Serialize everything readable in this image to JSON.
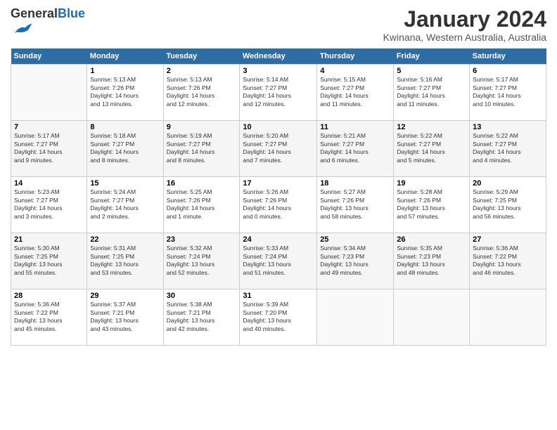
{
  "header": {
    "logo_general": "General",
    "logo_blue": "Blue",
    "title": "January 2024",
    "location": "Kwinana, Western Australia, Australia"
  },
  "columns": [
    "Sunday",
    "Monday",
    "Tuesday",
    "Wednesday",
    "Thursday",
    "Friday",
    "Saturday"
  ],
  "weeks": [
    [
      {
        "num": "",
        "info": ""
      },
      {
        "num": "1",
        "info": "Sunrise: 5:13 AM\nSunset: 7:26 PM\nDaylight: 14 hours\nand 13 minutes."
      },
      {
        "num": "2",
        "info": "Sunrise: 5:13 AM\nSunset: 7:26 PM\nDaylight: 14 hours\nand 12 minutes."
      },
      {
        "num": "3",
        "info": "Sunrise: 5:14 AM\nSunset: 7:27 PM\nDaylight: 14 hours\nand 12 minutes."
      },
      {
        "num": "4",
        "info": "Sunrise: 5:15 AM\nSunset: 7:27 PM\nDaylight: 14 hours\nand 11 minutes."
      },
      {
        "num": "5",
        "info": "Sunrise: 5:16 AM\nSunset: 7:27 PM\nDaylight: 14 hours\nand 11 minutes."
      },
      {
        "num": "6",
        "info": "Sunrise: 5:17 AM\nSunset: 7:27 PM\nDaylight: 14 hours\nand 10 minutes."
      }
    ],
    [
      {
        "num": "7",
        "info": "Sunrise: 5:17 AM\nSunset: 7:27 PM\nDaylight: 14 hours\nand 9 minutes."
      },
      {
        "num": "8",
        "info": "Sunrise: 5:18 AM\nSunset: 7:27 PM\nDaylight: 14 hours\nand 8 minutes."
      },
      {
        "num": "9",
        "info": "Sunrise: 5:19 AM\nSunset: 7:27 PM\nDaylight: 14 hours\nand 8 minutes."
      },
      {
        "num": "10",
        "info": "Sunrise: 5:20 AM\nSunset: 7:27 PM\nDaylight: 14 hours\nand 7 minutes."
      },
      {
        "num": "11",
        "info": "Sunrise: 5:21 AM\nSunset: 7:27 PM\nDaylight: 14 hours\nand 6 minutes."
      },
      {
        "num": "12",
        "info": "Sunrise: 5:22 AM\nSunset: 7:27 PM\nDaylight: 14 hours\nand 5 minutes."
      },
      {
        "num": "13",
        "info": "Sunrise: 5:22 AM\nSunset: 7:27 PM\nDaylight: 14 hours\nand 4 minutes."
      }
    ],
    [
      {
        "num": "14",
        "info": "Sunrise: 5:23 AM\nSunset: 7:27 PM\nDaylight: 14 hours\nand 3 minutes."
      },
      {
        "num": "15",
        "info": "Sunrise: 5:24 AM\nSunset: 7:27 PM\nDaylight: 14 hours\nand 2 minutes."
      },
      {
        "num": "16",
        "info": "Sunrise: 5:25 AM\nSunset: 7:26 PM\nDaylight: 14 hours\nand 1 minute."
      },
      {
        "num": "17",
        "info": "Sunrise: 5:26 AM\nSunset: 7:26 PM\nDaylight: 14 hours\nand 0 minutes."
      },
      {
        "num": "18",
        "info": "Sunrise: 5:27 AM\nSunset: 7:26 PM\nDaylight: 13 hours\nand 58 minutes."
      },
      {
        "num": "19",
        "info": "Sunrise: 5:28 AM\nSunset: 7:26 PM\nDaylight: 13 hours\nand 57 minutes."
      },
      {
        "num": "20",
        "info": "Sunrise: 5:29 AM\nSunset: 7:25 PM\nDaylight: 13 hours\nand 56 minutes."
      }
    ],
    [
      {
        "num": "21",
        "info": "Sunrise: 5:30 AM\nSunset: 7:25 PM\nDaylight: 13 hours\nand 55 minutes."
      },
      {
        "num": "22",
        "info": "Sunrise: 5:31 AM\nSunset: 7:25 PM\nDaylight: 13 hours\nand 53 minutes."
      },
      {
        "num": "23",
        "info": "Sunrise: 5:32 AM\nSunset: 7:24 PM\nDaylight: 13 hours\nand 52 minutes."
      },
      {
        "num": "24",
        "info": "Sunrise: 5:33 AM\nSunset: 7:24 PM\nDaylight: 13 hours\nand 51 minutes."
      },
      {
        "num": "25",
        "info": "Sunrise: 5:34 AM\nSunset: 7:23 PM\nDaylight: 13 hours\nand 49 minutes."
      },
      {
        "num": "26",
        "info": "Sunrise: 5:35 AM\nSunset: 7:23 PM\nDaylight: 13 hours\nand 48 minutes."
      },
      {
        "num": "27",
        "info": "Sunrise: 5:36 AM\nSunset: 7:22 PM\nDaylight: 13 hours\nand 46 minutes."
      }
    ],
    [
      {
        "num": "28",
        "info": "Sunrise: 5:36 AM\nSunset: 7:22 PM\nDaylight: 13 hours\nand 45 minutes."
      },
      {
        "num": "29",
        "info": "Sunrise: 5:37 AM\nSunset: 7:21 PM\nDaylight: 13 hours\nand 43 minutes."
      },
      {
        "num": "30",
        "info": "Sunrise: 5:38 AM\nSunset: 7:21 PM\nDaylight: 13 hours\nand 42 minutes."
      },
      {
        "num": "31",
        "info": "Sunrise: 5:39 AM\nSunset: 7:20 PM\nDaylight: 13 hours\nand 40 minutes."
      },
      {
        "num": "",
        "info": ""
      },
      {
        "num": "",
        "info": ""
      },
      {
        "num": "",
        "info": ""
      }
    ]
  ]
}
